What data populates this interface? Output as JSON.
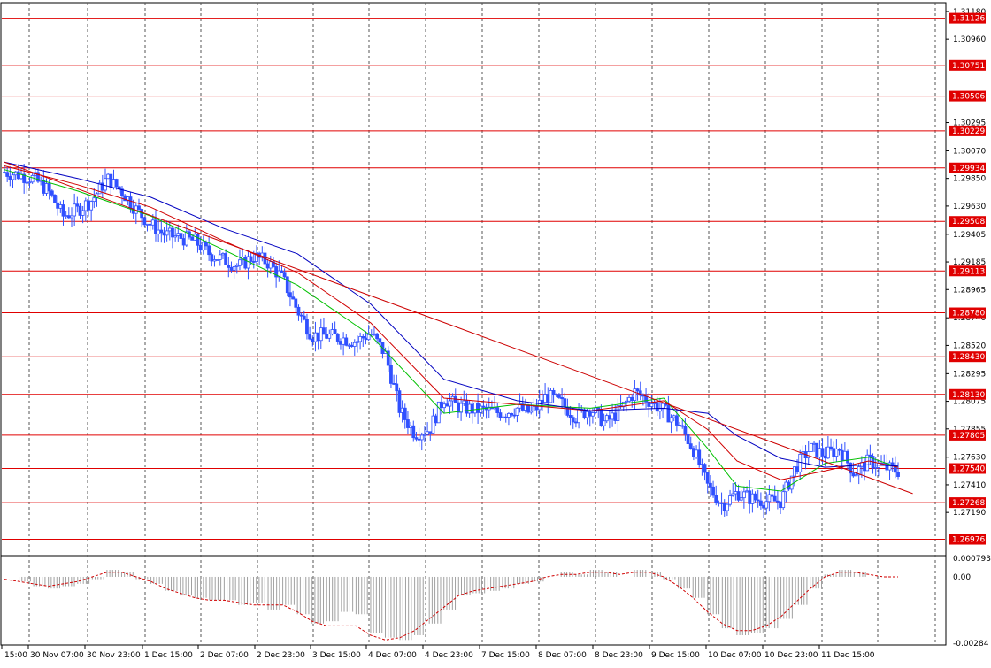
{
  "chart_data": {
    "type": "candlestick",
    "price_axis": {
      "ylim": [
        1.2686,
        1.3125
      ],
      "ticks": [
        "1.31180",
        "1.30960",
        "1.30295",
        "1.30070",
        "1.29850",
        "1.29630",
        "1.29405",
        "1.29185",
        "1.28965",
        "1.28740",
        "1.28520",
        "1.28295",
        "1.28075",
        "1.27855",
        "1.27630",
        "1.27410",
        "1.27190"
      ]
    },
    "horizontal_levels": [
      "1.31126",
      "1.30751",
      "1.30506",
      "1.30229",
      "1.29934",
      "1.29508",
      "1.29113",
      "1.28780",
      "1.28430",
      "1.28130",
      "1.27805",
      "1.27540",
      "1.27268",
      "1.26976"
    ],
    "time_axis": [
      "15:00",
      "30 Nov 07:00",
      "30 Nov 23:00",
      "1 Dec 15:00",
      "2 Dec 07:00",
      "2 Dec 23:00",
      "3 Dec 15:00",
      "4 Dec 07:00",
      "4 Dec 23:00",
      "7 Dec 15:00",
      "8 Dec 07:00",
      "8 Dec 23:00",
      "9 Dec 15:00",
      "10 Dec 07:00",
      "10 Dec 23:00",
      "11 Dec 15:00"
    ],
    "close_path": [
      [
        0,
        1.299
      ],
      [
        1,
        1.2988
      ],
      [
        2,
        1.2985
      ],
      [
        3,
        1.2975
      ],
      [
        4,
        1.2955
      ],
      [
        5,
        1.296
      ],
      [
        6,
        1.2968
      ],
      [
        7,
        1.2985
      ],
      [
        8,
        1.2975
      ],
      [
        9,
        1.296
      ],
      [
        10,
        1.2948
      ],
      [
        11,
        1.294
      ],
      [
        12,
        1.2938
      ],
      [
        13,
        1.2935
      ],
      [
        14,
        1.2925
      ],
      [
        15,
        1.292
      ],
      [
        16,
        1.2915
      ],
      [
        17,
        1.2923
      ],
      [
        18,
        1.2918
      ],
      [
        19,
        1.2905
      ],
      [
        20,
        1.288
      ],
      [
        21,
        1.286
      ],
      [
        22,
        1.286
      ],
      [
        23,
        1.2858
      ],
      [
        24,
        1.2855
      ],
      [
        25,
        1.2862
      ],
      [
        26,
        1.2845
      ],
      [
        27,
        1.28
      ],
      [
        28,
        1.2782
      ],
      [
        29,
        1.2785
      ],
      [
        30,
        1.281
      ],
      [
        31,
        1.2803
      ],
      [
        32,
        1.2801
      ],
      [
        33,
        1.28
      ],
      [
        34,
        1.2798
      ],
      [
        35,
        1.2802
      ],
      [
        36,
        1.2798
      ],
      [
        37,
        1.2812
      ],
      [
        38,
        1.2806
      ],
      [
        39,
        1.2795
      ],
      [
        40,
        1.2802
      ],
      [
        41,
        1.279
      ],
      [
        42,
        1.28
      ],
      [
        43,
        1.2815
      ],
      [
        44,
        1.2808
      ],
      [
        45,
        1.28
      ],
      [
        46,
        1.279
      ],
      [
        47,
        1.277
      ],
      [
        48,
        1.274
      ],
      [
        49,
        1.2725
      ],
      [
        50,
        1.2735
      ],
      [
        51,
        1.273
      ],
      [
        52,
        1.2728
      ],
      [
        53,
        1.2728
      ],
      [
        54,
        1.2755
      ],
      [
        55,
        1.277
      ],
      [
        56,
        1.2765
      ],
      [
        57,
        1.277
      ],
      [
        58,
        1.275
      ],
      [
        59,
        1.276
      ],
      [
        60,
        1.2755
      ],
      [
        61,
        1.2752
      ]
    ],
    "moving_averages": [
      {
        "color": "#00C000",
        "path": [
          [
            0,
            1.2992
          ],
          [
            5,
            1.2975
          ],
          [
            10,
            1.2955
          ],
          [
            15,
            1.2928
          ],
          [
            20,
            1.29
          ],
          [
            25,
            1.286
          ],
          [
            30,
            1.2798
          ],
          [
            35,
            1.2805
          ],
          [
            40,
            1.2802
          ],
          [
            45,
            1.281
          ],
          [
            48,
            1.277
          ],
          [
            50,
            1.274
          ],
          [
            53,
            1.2736
          ],
          [
            56,
            1.2758
          ],
          [
            59,
            1.2763
          ],
          [
            61,
            1.2755
          ]
        ]
      },
      {
        "color": "#D00000",
        "path": [
          [
            0,
            1.2995
          ],
          [
            5,
            1.298
          ],
          [
            10,
            1.2962
          ],
          [
            15,
            1.2935
          ],
          [
            20,
            1.291
          ],
          [
            25,
            1.287
          ],
          [
            30,
            1.281
          ],
          [
            35,
            1.2805
          ],
          [
            40,
            1.28
          ],
          [
            45,
            1.2808
          ],
          [
            48,
            1.2785
          ],
          [
            50,
            1.276
          ],
          [
            53,
            1.2745
          ],
          [
            56,
            1.2752
          ],
          [
            59,
            1.276
          ],
          [
            61,
            1.2755
          ]
        ]
      },
      {
        "color": "#0000C0",
        "path": [
          [
            0,
            1.2998
          ],
          [
            5,
            1.2985
          ],
          [
            10,
            1.297
          ],
          [
            15,
            1.2945
          ],
          [
            20,
            1.2925
          ],
          [
            25,
            1.2885
          ],
          [
            30,
            1.2825
          ],
          [
            35,
            1.2808
          ],
          [
            40,
            1.28
          ],
          [
            45,
            1.2802
          ],
          [
            48,
            1.2798
          ],
          [
            50,
            1.278
          ],
          [
            53,
            1.2762
          ],
          [
            56,
            1.2755
          ],
          [
            59,
            1.2757
          ],
          [
            61,
            1.2756
          ]
        ]
      }
    ],
    "trendline": {
      "color": "#CC0000",
      "from": [
        0,
        1.2998
      ],
      "to": [
        62,
        1.2734
      ]
    },
    "indicator": {
      "ylim": [
        -0.00284,
        0.000793
      ],
      "ticks": [
        "0.000793",
        "0.00",
        "-0.00284"
      ],
      "histogram": [
        0.0,
        -0.0002,
        -0.0004,
        -0.0005,
        -0.0004,
        -0.0003,
        -0.0001,
        0.0003,
        0.0002,
        -0.0001,
        -0.0003,
        -0.0006,
        -0.0008,
        -0.0009,
        -0.001,
        -0.001,
        -0.0012,
        -0.0011,
        -0.0014,
        -0.0012,
        -0.0016,
        -0.002,
        -0.0019,
        -0.0015,
        -0.0016,
        -0.0024,
        -0.0026,
        -0.0027,
        -0.0025,
        -0.002,
        -0.0014,
        -0.0008,
        -0.0007,
        -0.0006,
        -0.0005,
        -0.0003,
        -0.0002,
        0.0,
        0.0002,
        0.0001,
        0.0003,
        0.0002,
        0.0,
        0.0003,
        0.0002,
        -0.0001,
        -0.0005,
        -0.0009,
        -0.0016,
        -0.0022,
        -0.0025,
        -0.0024,
        -0.0022,
        -0.0018,
        -0.0012,
        -0.0005,
        0.0001,
        0.0003,
        0.0002,
        0.0,
        -0.0001,
        0.0
      ],
      "signal": [
        -0.0001,
        -0.0002,
        -0.0003,
        -0.0004,
        -0.0003,
        -0.0002,
        0.0,
        0.0002,
        0.0002,
        0.0,
        -0.0002,
        -0.0005,
        -0.0007,
        -0.0009,
        -0.001,
        -0.001,
        -0.0011,
        -0.0012,
        -0.0012,
        -0.0012,
        -0.0015,
        -0.0019,
        -0.0021,
        -0.0021,
        -0.0021,
        -0.0025,
        -0.0027,
        -0.0026,
        -0.0023,
        -0.0018,
        -0.0013,
        -0.0008,
        -0.0006,
        -0.0005,
        -0.0004,
        -0.0003,
        -0.0002,
        0.0,
        0.0001,
        0.0001,
        0.0002,
        0.0002,
        0.0001,
        0.0002,
        0.0002,
        0.0,
        -0.0004,
        -0.0009,
        -0.0015,
        -0.002,
        -0.0023,
        -0.0023,
        -0.0021,
        -0.0017,
        -0.0011,
        -0.0005,
        0.0,
        0.0002,
        0.0002,
        0.0001,
        0.0,
        0.0
      ]
    }
  },
  "colors": {
    "candle": "#3050FF",
    "level": "#E00000",
    "grid": "#555555",
    "label_bg": "#E00000",
    "label_text": "#FFFFFF"
  }
}
